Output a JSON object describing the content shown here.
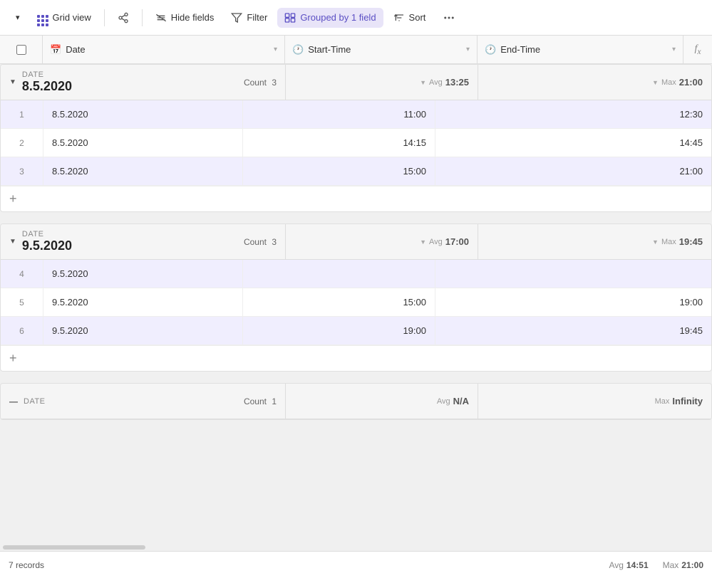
{
  "toolbar": {
    "dropdown_arrow": "▾",
    "grid_view_label": "Grid view",
    "share_label": "",
    "hide_fields_label": "Hide fields",
    "filter_label": "Filter",
    "grouped_label": "Grouped by 1 field",
    "sort_label": "Sort",
    "more_label": "..."
  },
  "header": {
    "checkbox_col": "",
    "date_col": "Date",
    "start_col": "Start-Time",
    "end_col": "End-Time",
    "fx_col": "fx"
  },
  "groups": [
    {
      "id": "group1",
      "label": "DATE",
      "date": "8.5.2020",
      "count_label": "Count",
      "count": 3,
      "avg_label": "Avg",
      "avg_value": "13:25",
      "max_label": "Max",
      "max_value": "21:00",
      "rows": [
        {
          "num": 1,
          "date": "8.5.2020",
          "start": "11:00",
          "end": "12:30",
          "highlighted": true
        },
        {
          "num": 2,
          "date": "8.5.2020",
          "start": "14:15",
          "end": "14:45",
          "highlighted": false
        },
        {
          "num": 3,
          "date": "8.5.2020",
          "start": "15:00",
          "end": "21:00",
          "highlighted": true
        }
      ]
    },
    {
      "id": "group2",
      "label": "DATE",
      "date": "9.5.2020",
      "count_label": "Count",
      "count": 3,
      "avg_label": "Avg",
      "avg_value": "17:00",
      "max_label": "Max",
      "max_value": "19:45",
      "rows": [
        {
          "num": 4,
          "date": "9.5.2020",
          "start": "",
          "end": "",
          "highlighted": true
        },
        {
          "num": 5,
          "date": "9.5.2020",
          "start": "15:00",
          "end": "19:00",
          "highlighted": false
        },
        {
          "num": 6,
          "date": "9.5.2020",
          "start": "19:00",
          "end": "19:45",
          "highlighted": true
        }
      ]
    }
  ],
  "partial_group": {
    "label": "DATE",
    "count_label": "Count",
    "count": 1,
    "avg_label": "Avg",
    "avg_value": "N/A",
    "max_label": "Max",
    "max_value": "Infinity"
  },
  "footer": {
    "records_label": "7 records",
    "avg_label": "Avg",
    "avg_value": "14:51",
    "max_label": "Max",
    "max_value": "21:00"
  }
}
